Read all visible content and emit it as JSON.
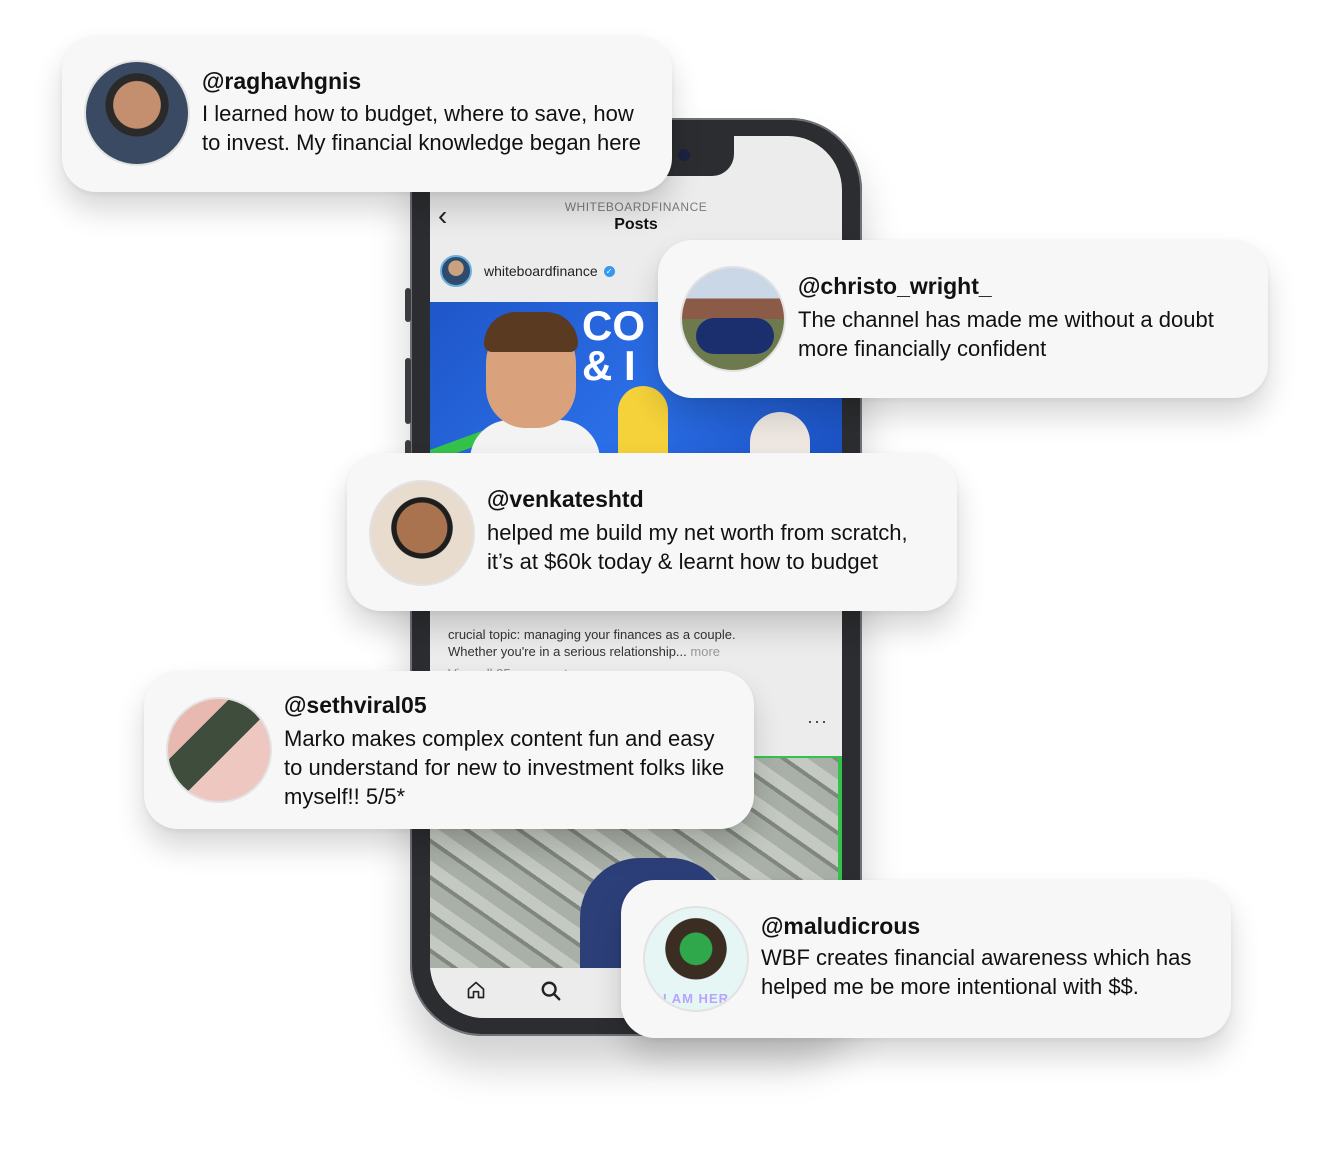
{
  "phone": {
    "account_label": "WHITEBOARDFINANCE",
    "title": "Posts",
    "username": "whiteboardfinance",
    "thumbnail_text_line1": "CO",
    "thumbnail_text_line2": "& I",
    "caption_line1": "crucial topic: managing your finances as a couple.",
    "caption_line2": "Whether you're in a serious relationship...",
    "caption_more": "more",
    "view_comments": "View all 85 comments",
    "more_menu": "···",
    "back_icon": "chevron-left-icon",
    "nav_icons": [
      "home-icon",
      "search-icon"
    ]
  },
  "testimonials": [
    {
      "handle": "@raghavhgnis",
      "text_line1": "I learned how to budget, where to save, how",
      "text_line2": "to invest. My financial knowledge began here"
    },
    {
      "handle": "@christo_wright_",
      "text_line1": "The channel has made me without a doubt",
      "text_line2": "more financially confident"
    },
    {
      "handle": "@venkateshtd",
      "text_line1": "helped me build my net worth from scratch,",
      "text_line2": "it’s at $60k today & learnt how to budget"
    },
    {
      "handle": "@sethviral05",
      "text_line1": "Marko makes complex content fun and easy",
      "text_line2": "to understand for new to investment folks like",
      "text_line3": "myself!! 5/5*"
    },
    {
      "handle": "@maludicrous",
      "text_line1": "WBF creates financial awareness which has",
      "text_line2": "helped me be more intentional with $$.",
      "avatar_text": "I AM HER"
    }
  ]
}
